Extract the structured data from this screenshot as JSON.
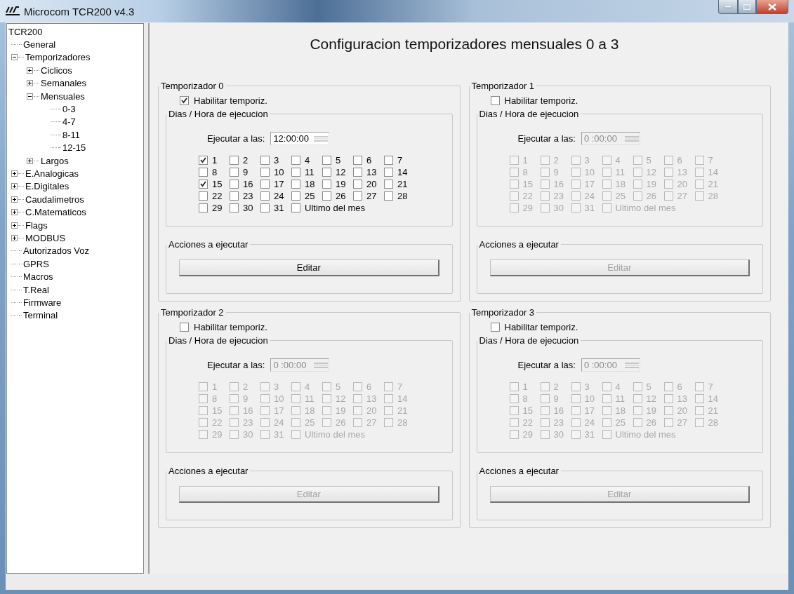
{
  "window": {
    "title": "Microcom TCR200 v4.3"
  },
  "tree": {
    "label": "TCR200",
    "children": [
      {
        "label": "General"
      },
      {
        "label": "Temporizadores",
        "expanded": true,
        "children": [
          {
            "label": "Ciclicos",
            "expanded": false
          },
          {
            "label": "Semanales",
            "expanded": false
          },
          {
            "label": "Mensuales",
            "expanded": true,
            "children": [
              {
                "label": "0-3"
              },
              {
                "label": "4-7"
              },
              {
                "label": "8-11"
              },
              {
                "label": "12-15"
              }
            ]
          },
          {
            "label": "Largos",
            "expanded": false
          }
        ]
      },
      {
        "label": "E.Analogicas",
        "expanded": false
      },
      {
        "label": "E.Digitales",
        "expanded": false
      },
      {
        "label": "Caudalimetros",
        "expanded": false
      },
      {
        "label": "C.Matematicos",
        "expanded": false
      },
      {
        "label": "Flags",
        "expanded": false
      },
      {
        "label": "MODBUS",
        "expanded": false
      },
      {
        "label": "Autorizados Voz"
      },
      {
        "label": "GPRS"
      },
      {
        "label": "Macros"
      },
      {
        "label": "T.Real"
      },
      {
        "label": "Firmware"
      },
      {
        "label": "Terminal"
      }
    ]
  },
  "page_title": "Configuracion temporizadores mensuales  0 a 3",
  "timers": [
    {
      "title": "Temporizador  0",
      "disabled": false,
      "enable": {
        "label": "Habilitar temporiz.",
        "checked": true
      },
      "schedule": {
        "legend": "Dias / Hora de ejecucion",
        "time_label": "Ejecutar a las:",
        "time_value": "12:00:00",
        "days": [
          {
            "label": "1",
            "checked": true
          },
          {
            "label": "2",
            "checked": false
          },
          {
            "label": "3",
            "checked": false
          },
          {
            "label": "4",
            "checked": false
          },
          {
            "label": "5",
            "checked": false
          },
          {
            "label": "6",
            "checked": false
          },
          {
            "label": "7",
            "checked": false
          },
          {
            "label": "8",
            "checked": false
          },
          {
            "label": "9",
            "checked": false
          },
          {
            "label": "10",
            "checked": false
          },
          {
            "label": "11",
            "checked": false
          },
          {
            "label": "12",
            "checked": false
          },
          {
            "label": "13",
            "checked": false
          },
          {
            "label": "14",
            "checked": false
          },
          {
            "label": "15",
            "checked": true
          },
          {
            "label": "16",
            "checked": false
          },
          {
            "label": "17",
            "checked": false
          },
          {
            "label": "18",
            "checked": false
          },
          {
            "label": "19",
            "checked": false
          },
          {
            "label": "20",
            "checked": false
          },
          {
            "label": "21",
            "checked": false
          },
          {
            "label": "22",
            "checked": false
          },
          {
            "label": "23",
            "checked": false
          },
          {
            "label": "24",
            "checked": false
          },
          {
            "label": "25",
            "checked": false
          },
          {
            "label": "26",
            "checked": false
          },
          {
            "label": "27",
            "checked": false
          },
          {
            "label": "28",
            "checked": false
          },
          {
            "label": "29",
            "checked": false
          },
          {
            "label": "30",
            "checked": false
          },
          {
            "label": "31",
            "checked": false
          },
          {
            "label": "Ultimo del mes",
            "checked": false
          }
        ]
      },
      "actions": {
        "legend": "Acciones a ejecutar",
        "button": "Editar"
      }
    },
    {
      "title": "Temporizador  1",
      "disabled": true,
      "enable": {
        "label": "Habilitar temporiz.",
        "checked": false
      },
      "schedule": {
        "legend": "Dias / Hora de ejecucion",
        "time_label": "Ejecutar a las:",
        "time_value": "0 :00:00",
        "days": [
          {
            "label": "1",
            "checked": false
          },
          {
            "label": "2",
            "checked": false
          },
          {
            "label": "3",
            "checked": false
          },
          {
            "label": "4",
            "checked": false
          },
          {
            "label": "5",
            "checked": false
          },
          {
            "label": "6",
            "checked": false
          },
          {
            "label": "7",
            "checked": false
          },
          {
            "label": "8",
            "checked": false
          },
          {
            "label": "9",
            "checked": false
          },
          {
            "label": "10",
            "checked": false
          },
          {
            "label": "11",
            "checked": false
          },
          {
            "label": "12",
            "checked": false
          },
          {
            "label": "13",
            "checked": false
          },
          {
            "label": "14",
            "checked": false
          },
          {
            "label": "15",
            "checked": false
          },
          {
            "label": "16",
            "checked": false
          },
          {
            "label": "17",
            "checked": false
          },
          {
            "label": "18",
            "checked": false
          },
          {
            "label": "19",
            "checked": false
          },
          {
            "label": "20",
            "checked": false
          },
          {
            "label": "21",
            "checked": false
          },
          {
            "label": "22",
            "checked": false
          },
          {
            "label": "23",
            "checked": false
          },
          {
            "label": "24",
            "checked": false
          },
          {
            "label": "25",
            "checked": false
          },
          {
            "label": "26",
            "checked": false
          },
          {
            "label": "27",
            "checked": false
          },
          {
            "label": "28",
            "checked": false
          },
          {
            "label": "29",
            "checked": false
          },
          {
            "label": "30",
            "checked": false
          },
          {
            "label": "31",
            "checked": false
          },
          {
            "label": "Ultimo del mes",
            "checked": false
          }
        ]
      },
      "actions": {
        "legend": "Acciones a ejecutar",
        "button": "Editar"
      }
    },
    {
      "title": "Temporizador  2",
      "disabled": true,
      "enable": {
        "label": "Habilitar temporiz.",
        "checked": false
      },
      "schedule": {
        "legend": "Dias / Hora de ejecucion",
        "time_label": "Ejecutar a las:",
        "time_value": "0 :00:00",
        "days": [
          {
            "label": "1",
            "checked": false
          },
          {
            "label": "2",
            "checked": false
          },
          {
            "label": "3",
            "checked": false
          },
          {
            "label": "4",
            "checked": false
          },
          {
            "label": "5",
            "checked": false
          },
          {
            "label": "6",
            "checked": false
          },
          {
            "label": "7",
            "checked": false
          },
          {
            "label": "8",
            "checked": false
          },
          {
            "label": "9",
            "checked": false
          },
          {
            "label": "10",
            "checked": false
          },
          {
            "label": "11",
            "checked": false
          },
          {
            "label": "12",
            "checked": false
          },
          {
            "label": "13",
            "checked": false
          },
          {
            "label": "14",
            "checked": false
          },
          {
            "label": "15",
            "checked": false
          },
          {
            "label": "16",
            "checked": false
          },
          {
            "label": "17",
            "checked": false
          },
          {
            "label": "18",
            "checked": false
          },
          {
            "label": "19",
            "checked": false
          },
          {
            "label": "20",
            "checked": false
          },
          {
            "label": "21",
            "checked": false
          },
          {
            "label": "22",
            "checked": false
          },
          {
            "label": "23",
            "checked": false
          },
          {
            "label": "24",
            "checked": false
          },
          {
            "label": "25",
            "checked": false
          },
          {
            "label": "26",
            "checked": false
          },
          {
            "label": "27",
            "checked": false
          },
          {
            "label": "28",
            "checked": false
          },
          {
            "label": "29",
            "checked": false
          },
          {
            "label": "30",
            "checked": false
          },
          {
            "label": "31",
            "checked": false
          },
          {
            "label": "Ultimo del mes",
            "checked": false
          }
        ]
      },
      "actions": {
        "legend": "Acciones a ejecutar",
        "button": "Editar"
      }
    },
    {
      "title": "Temporizador  3",
      "disabled": true,
      "enable": {
        "label": "Habilitar temporiz.",
        "checked": false
      },
      "schedule": {
        "legend": "Dias / Hora de ejecucion",
        "time_label": "Ejecutar a las:",
        "time_value": "0 :00:00",
        "days": [
          {
            "label": "1",
            "checked": false
          },
          {
            "label": "2",
            "checked": false
          },
          {
            "label": "3",
            "checked": false
          },
          {
            "label": "4",
            "checked": false
          },
          {
            "label": "5",
            "checked": false
          },
          {
            "label": "6",
            "checked": false
          },
          {
            "label": "7",
            "checked": false
          },
          {
            "label": "8",
            "checked": false
          },
          {
            "label": "9",
            "checked": false
          },
          {
            "label": "10",
            "checked": false
          },
          {
            "label": "11",
            "checked": false
          },
          {
            "label": "12",
            "checked": false
          },
          {
            "label": "13",
            "checked": false
          },
          {
            "label": "14",
            "checked": false
          },
          {
            "label": "15",
            "checked": false
          },
          {
            "label": "16",
            "checked": false
          },
          {
            "label": "17",
            "checked": false
          },
          {
            "label": "18",
            "checked": false
          },
          {
            "label": "19",
            "checked": false
          },
          {
            "label": "20",
            "checked": false
          },
          {
            "label": "21",
            "checked": false
          },
          {
            "label": "22",
            "checked": false
          },
          {
            "label": "23",
            "checked": false
          },
          {
            "label": "24",
            "checked": false
          },
          {
            "label": "25",
            "checked": false
          },
          {
            "label": "26",
            "checked": false
          },
          {
            "label": "27",
            "checked": false
          },
          {
            "label": "28",
            "checked": false
          },
          {
            "label": "29",
            "checked": false
          },
          {
            "label": "30",
            "checked": false
          },
          {
            "label": "31",
            "checked": false
          },
          {
            "label": "Ultimo del mes",
            "checked": false
          }
        ]
      },
      "actions": {
        "legend": "Acciones a ejecutar",
        "button": "Editar"
      }
    }
  ]
}
